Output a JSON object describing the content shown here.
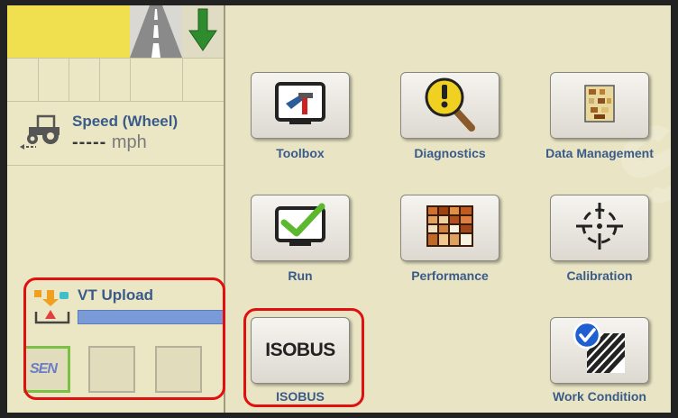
{
  "speed": {
    "title": "Speed (Wheel)",
    "dashes": "-----",
    "unit": "mph"
  },
  "vt_upload": {
    "title": "VT Upload",
    "progress": 1.0,
    "slot_label": "SEN"
  },
  "menu": {
    "items": [
      {
        "label": "Toolbox",
        "icon": "toolbox-icon"
      },
      {
        "label": "Diagnostics",
        "icon": "diagnostics-icon"
      },
      {
        "label": "Data Management",
        "icon": "data-management-icon"
      },
      {
        "label": "Run",
        "icon": "run-icon"
      },
      {
        "label": "Performance",
        "icon": "performance-icon"
      },
      {
        "label": "Calibration",
        "icon": "calibration-icon"
      },
      {
        "label": "ISOBUS",
        "icon": "isobus-icon",
        "icon_text": "ISOBUS"
      },
      {
        "label": "Work Condition",
        "icon": "work-condition-icon"
      }
    ]
  },
  "colors": {
    "panel_bg": "#e8e4c4",
    "label_blue": "#3a5b8a",
    "highlight_red": "#e01010",
    "progress_blue": "#7b9bd8",
    "check_green": "#5cb82e"
  }
}
